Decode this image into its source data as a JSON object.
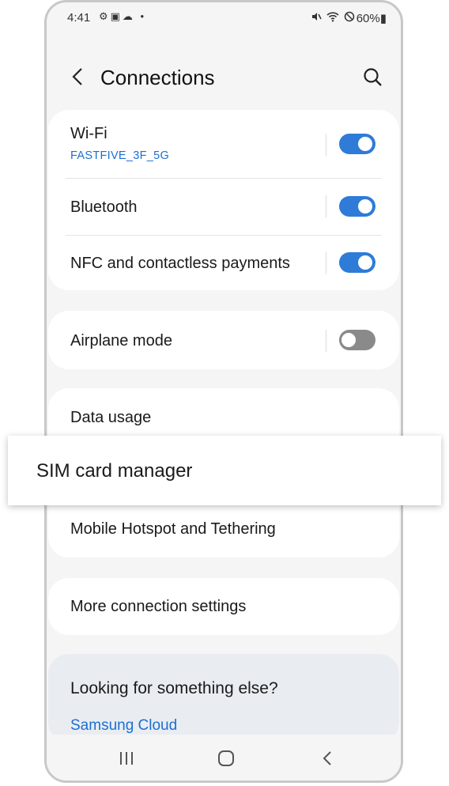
{
  "status": {
    "time": "4:41",
    "left_icons": "⚙▣☁ •",
    "right_icons": "🔇 ≋ ⊘",
    "battery": "60%▮"
  },
  "header": {
    "title": "Connections",
    "back_icon": "chevron-left-icon",
    "search_icon": "search-icon"
  },
  "group1": [
    {
      "label": "Wi-Fi",
      "sub": "FASTFIVE_3F_5G",
      "toggle": "on"
    },
    {
      "label": "Bluetooth",
      "toggle": "on"
    },
    {
      "label": "NFC and contactless payments",
      "toggle": "on"
    }
  ],
  "group2": [
    {
      "label": "Airplane mode",
      "toggle": "off"
    }
  ],
  "group3": [
    {
      "label": "Data usage"
    },
    {
      "label": "SIM card manager"
    },
    {
      "label": "Mobile Hotspot and Tethering"
    }
  ],
  "group4": [
    {
      "label": "More connection settings"
    }
  ],
  "suggest": {
    "question": "Looking for something else?",
    "link": "Samsung Cloud"
  },
  "colors": {
    "accent": "#2e7bd8",
    "link": "#1c6fd1",
    "background": "#f5f5f5"
  }
}
